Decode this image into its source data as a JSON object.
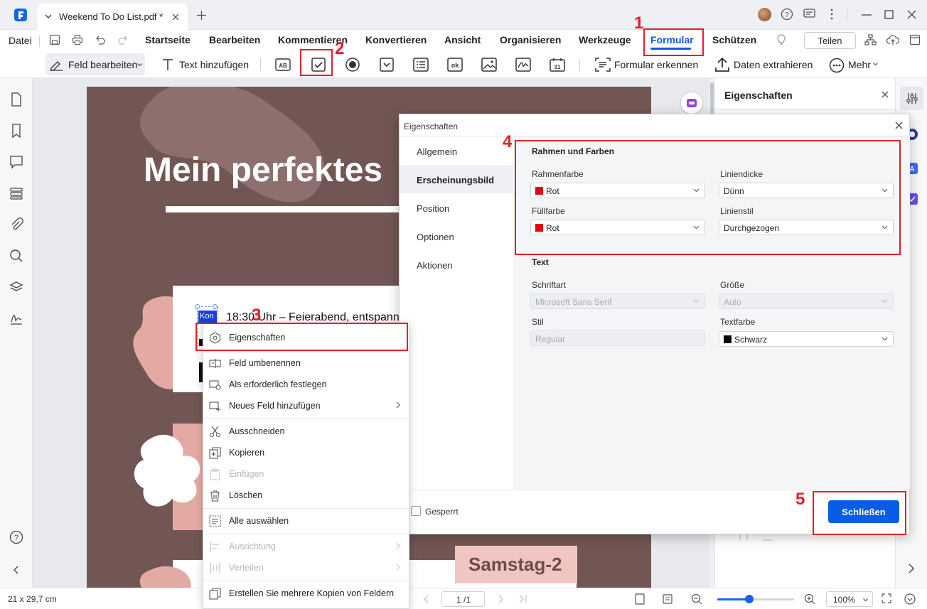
{
  "titlebar": {
    "tab_title": "Weekend To Do List.pdf *"
  },
  "menubar": {
    "datei": "Datei",
    "items": [
      "Startseite",
      "Bearbeiten",
      "Kommentieren",
      "Konvertieren",
      "Ansicht",
      "Organisieren",
      "Werkzeuge",
      "Formular",
      "Schützen"
    ],
    "share": "Teilen"
  },
  "toolbar": {
    "feld_bearbeiten": "Feld bearbeiten",
    "text_hinzufuegen": "Text hinzufügen",
    "formular_erkennen": "Formular erkennen",
    "daten_extrahieren": "Daten extrahieren",
    "mehr": "Mehr"
  },
  "document": {
    "title": "Mein perfektes",
    "item_time": "18:30 Uhr – Feierabend, entspann",
    "field_tag": "Kon",
    "day_label": "Samstag-2"
  },
  "right_panel": {
    "title": "Eigenschaften"
  },
  "dialog": {
    "title": "Eigenschaften",
    "nav": [
      "Allgemein",
      "Erscheinungsbild",
      "Position",
      "Optionen",
      "Aktionen"
    ],
    "active_nav": "Erscheinungsbild",
    "section_frame": "Rahmen und Farben",
    "rahmenfarbe_label": "Rahmenfarbe",
    "rahmenfarbe_value": "Rot",
    "liniendicke_label": "Liniendicke",
    "liniendicke_value": "Dünn",
    "fuellfarbe_label": "Füllfarbe",
    "fuellfarbe_value": "Rot",
    "linienstil_label": "Linienstil",
    "linienstil_value": "Durchgezogen",
    "section_text": "Text",
    "schriftart_label": "Schriftart",
    "schriftart_value": "Microsoft Sans Serif",
    "groesse_label": "Größe",
    "groesse_value": "Auto",
    "stil_label": "Stil",
    "stil_value": "Regular",
    "textfarbe_label": "Textfarbe",
    "textfarbe_value": "Schwarz",
    "locked_label": "Gesperrt",
    "close_button": "Schließen",
    "colors": {
      "red": "#e8000b",
      "black": "#000000",
      "accent": "#0a5ce6"
    }
  },
  "context_menu": {
    "items": [
      {
        "label": "Eigenschaften",
        "icon": "properties-icon",
        "disabled": false
      },
      {
        "label": "Feld umbenennen",
        "icon": "rename-icon",
        "disabled": false
      },
      {
        "label": "Als erforderlich festlegen",
        "icon": "required-icon",
        "disabled": false
      },
      {
        "label": "Neues Feld hinzufügen",
        "icon": "add-field-icon",
        "disabled": false,
        "submenu": true
      },
      {
        "label": "Ausschneiden",
        "icon": "scissors-icon",
        "disabled": false
      },
      {
        "label": "Kopieren",
        "icon": "copy-icon",
        "disabled": false
      },
      {
        "label": "Einfügen",
        "icon": "paste-icon",
        "disabled": true
      },
      {
        "label": "Löschen",
        "icon": "trash-icon",
        "disabled": false
      },
      {
        "label": "Alle auswählen",
        "icon": "select-all-icon",
        "disabled": false
      },
      {
        "label": "Ausrichtung",
        "icon": "align-icon",
        "disabled": true,
        "submenu": true
      },
      {
        "label": "Verteilen",
        "icon": "distribute-icon",
        "disabled": true,
        "submenu": true
      },
      {
        "label": "Erstellen Sie mehrere Kopien von Feldern",
        "icon": "multi-copy-icon",
        "disabled": false
      }
    ]
  },
  "statusbar": {
    "page_size": "21 x 29,7 cm",
    "page_indicator": "1 /1",
    "zoom": "100%",
    "zoom_level": 0.42
  },
  "annotations": [
    "1",
    "2",
    "3",
    "4",
    "5"
  ]
}
